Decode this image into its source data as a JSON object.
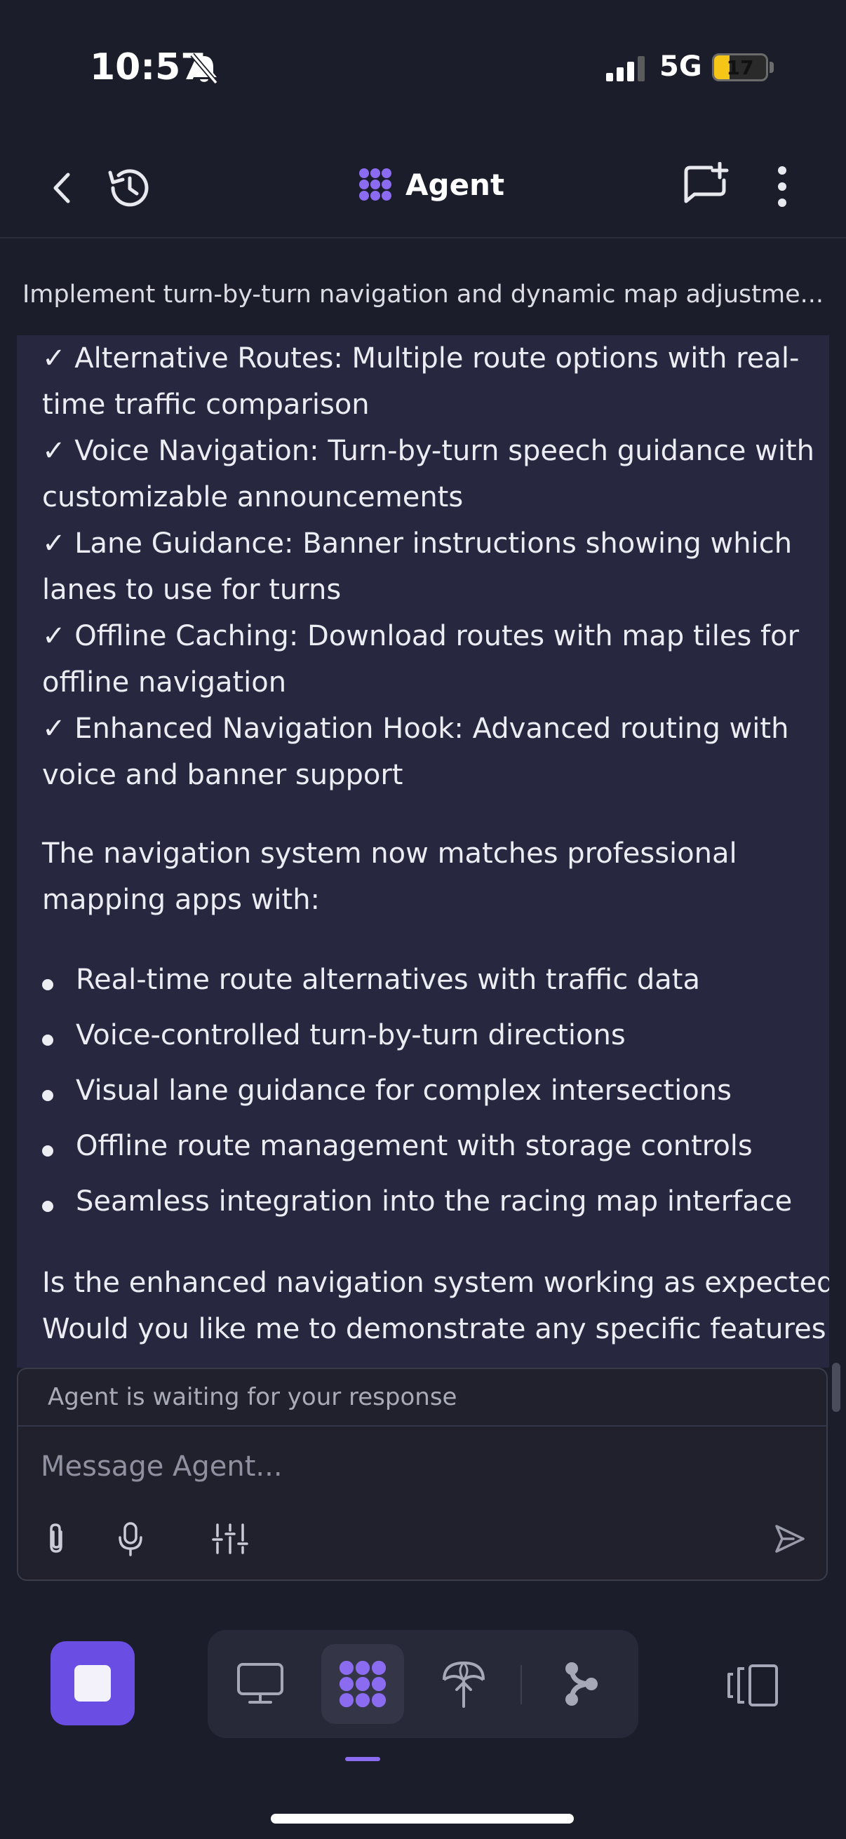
{
  "status_bar": {
    "time": "10:57",
    "network": "5G",
    "battery": "17"
  },
  "header": {
    "title": "Agent",
    "back_icon": "chevron-left-icon",
    "history_icon": "history-icon",
    "new_chat_icon": "new-chat-icon",
    "menu_icon": "more-vertical-icon"
  },
  "task_title": "Implement turn-by-turn navigation and dynamic map adjustme...",
  "message": {
    "lines": [
      "✓ Alternative Routes: Multiple route options with real-",
      "time traffic comparison",
      "✓ Voice Navigation: Turn-by-turn speech guidance with",
      "customizable announcements",
      "✓ Lane Guidance: Banner instructions showing which",
      "lanes to use for turns",
      "✓ Offline Caching: Download routes with map tiles for",
      "offline navigation",
      "✓ Enhanced Navigation Hook: Advanced routing with",
      "voice and banner support",
      "The navigation system now matches professional",
      "mapping apps with:"
    ],
    "bullets": [
      "Real-time route alternatives with traffic data",
      "Voice-controlled turn-by-turn directions",
      "Visual lane guidance for complex intersections",
      "Offline route management with storage controls",
      "Seamless integration into the racing map interface"
    ],
    "closing_lines": [
      "Is the enhanced navigation system working as expected?",
      "Would you like me to demonstrate any specific features"
    ]
  },
  "composer": {
    "status": "Agent is waiting for your response",
    "placeholder": "Message Agent..."
  },
  "bottom_nav": {
    "items": [
      "preview-icon",
      "agent-icon",
      "deploy-icon",
      "git-icon"
    ],
    "active": "agent-icon"
  },
  "colors": {
    "background": "#1c1d2a",
    "message_panel": "#27273f",
    "accent": "#6a4ee3",
    "agent_icon": "#8b6cf0"
  }
}
